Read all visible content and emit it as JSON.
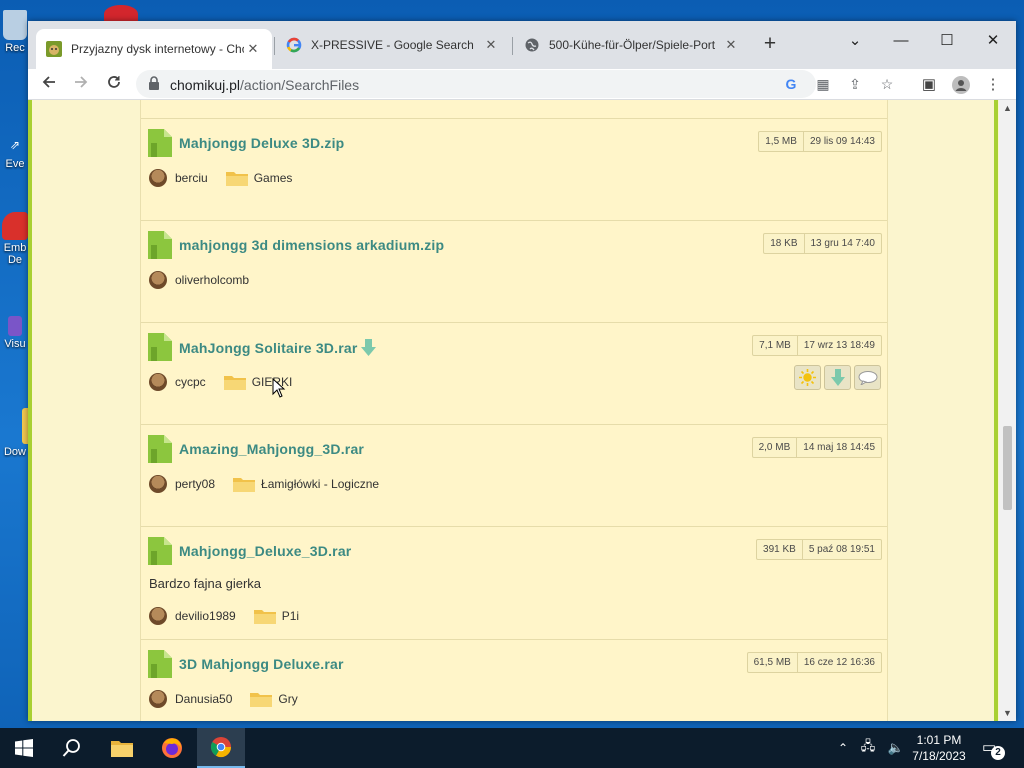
{
  "desktop": {
    "icons": [
      {
        "label": "Rec",
        "glyph": "recycle-bin-icon",
        "color": "#9fb8d0"
      },
      {
        "label": "Eve",
        "glyph": "app-shortcut-icon",
        "color": "#ffffff"
      },
      {
        "label": "Emb",
        "label2": "De",
        "glyph": "app-shortcut-icon",
        "color": "#d9302b"
      },
      {
        "label": "Visu",
        "glyph": "visual-studio-icon",
        "color": "#7a55c8"
      },
      {
        "label": "Dow",
        "glyph": "folder-icon",
        "color": "#f3c94f"
      }
    ]
  },
  "browser": {
    "tabs": [
      {
        "title": "Przyjazny dysk internetowy - Cho",
        "favicon": "chomikuj-favicon",
        "active": true
      },
      {
        "title": "X-PRESSIVE - Google Search",
        "favicon": "google-favicon",
        "active": false
      },
      {
        "title": "500-Kühe-für-Ölper/Spiele-Port",
        "favicon": "globe-favicon",
        "active": false
      }
    ],
    "tab_close_glyph": "✕",
    "new_tab_glyph": "+",
    "window_controls": {
      "tab_search": "⌄",
      "minimize": "—",
      "maximize": "☐",
      "close": "✕"
    },
    "url_domain": "chomikuj.pl",
    "url_path": "/action/SearchFiles"
  },
  "results": [
    {
      "name": "Mahjongg Deluxe 3D.zip",
      "size": "1,5 MB",
      "date": "29 lis 09 14:43",
      "owner": "berciu",
      "folder": "Games",
      "description": "",
      "hover": false
    },
    {
      "name": "mahjongg 3d dimensions arkadium.zip",
      "size": "18 KB",
      "date": "13 gru 14 7:40",
      "owner": "oliverholcomb",
      "folder": "",
      "description": "",
      "hover": false
    },
    {
      "name": "MahJongg Solitaire 3D.rar",
      "size": "7,1 MB",
      "date": "17 wrz 13 18:49",
      "owner": "cycpc",
      "folder": "GIERKI",
      "description": "",
      "hover": true
    },
    {
      "name": "Amazing_Mahjongg_3D.rar",
      "size": "2,0 MB",
      "date": "14 maj 18 14:45",
      "owner": "perty08",
      "folder": "Łamigłówki - Logiczne",
      "description": "",
      "hover": false
    },
    {
      "name": "Mahjongg_Deluxe_3D.rar",
      "size": "391 KB",
      "date": "5 paź 08 19:51",
      "owner": "devilio1989",
      "folder": "P1i",
      "description": "Bardzo fajna gierka",
      "hover": false
    },
    {
      "name": "3D Mahjongg Deluxe.rar",
      "size": "61,5 MB",
      "date": "16 cze 12 16:36",
      "owner": "Danusia50",
      "folder": "Gry",
      "description": "",
      "hover": false
    }
  ],
  "taskbar": {
    "time": "1:01 PM",
    "date": "7/18/2023",
    "notification_count": "2"
  },
  "colors": {
    "link": "#3c8a83",
    "accent_green": "#a9d031",
    "page_bg": "#fbf5ce",
    "taskbar_bg": "#0c1c2c"
  }
}
